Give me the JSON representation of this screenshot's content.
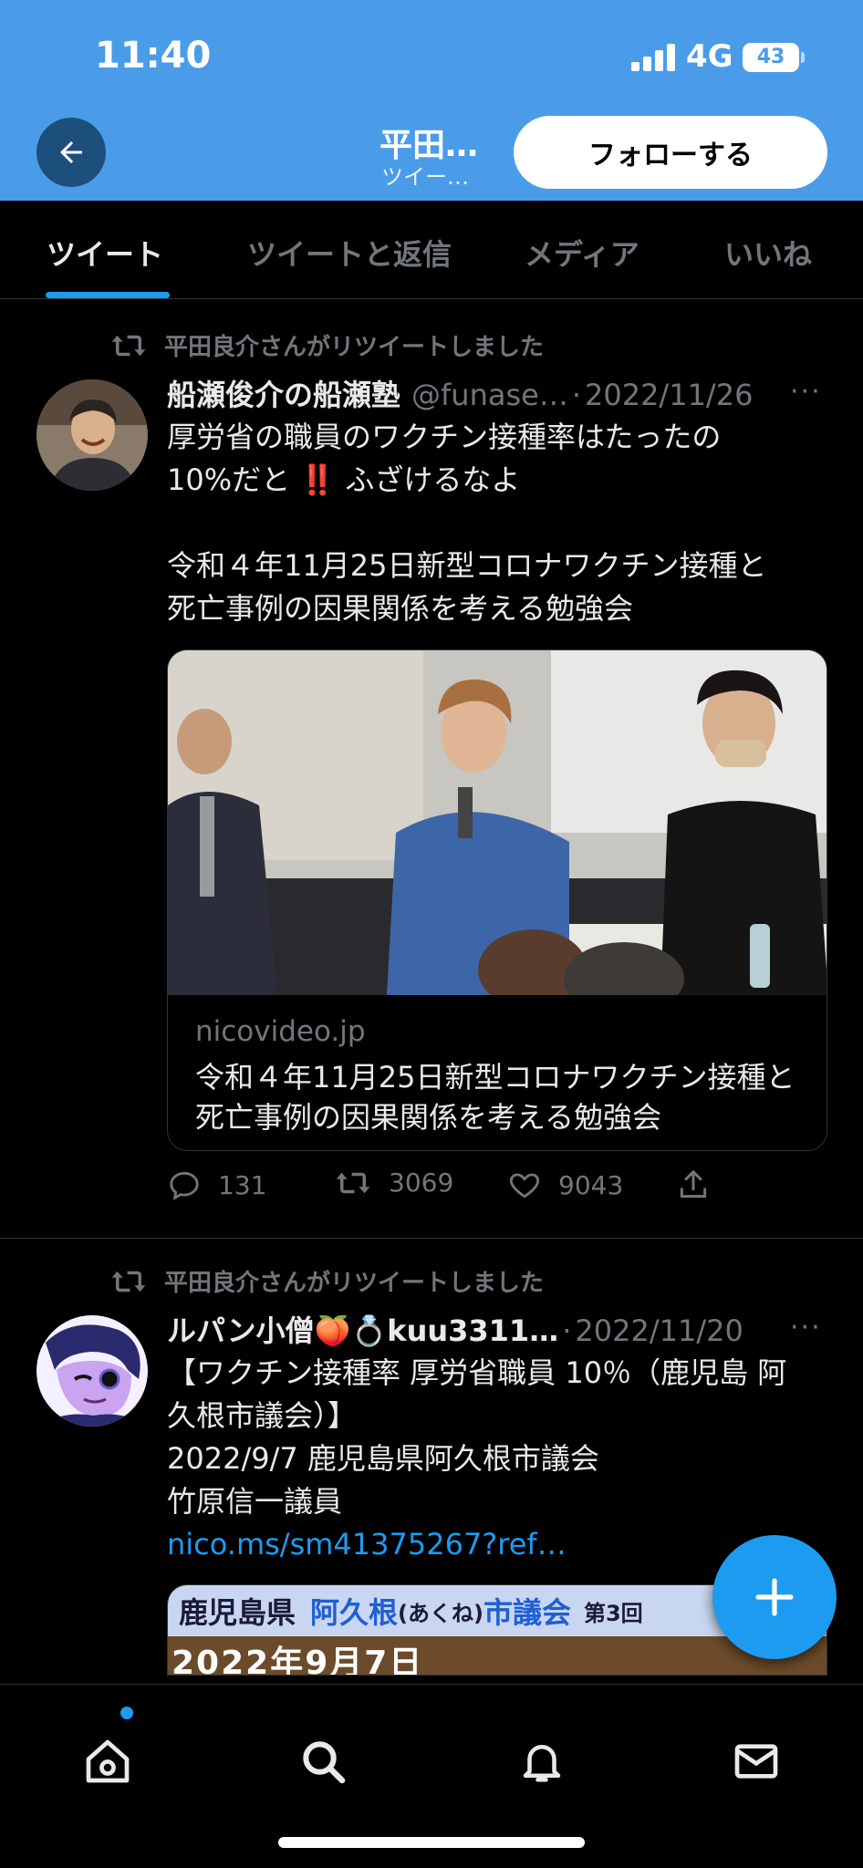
{
  "status_bar": {
    "time": "11:40",
    "network": "4G",
    "battery": "43"
  },
  "header": {
    "name": "平田…",
    "subtitle": "ツイー…",
    "follow_label": "フォローする"
  },
  "tabs": [
    {
      "label": "ツイート",
      "active": true
    },
    {
      "label": "ツイートと返信",
      "active": false
    },
    {
      "label": "メディア",
      "active": false
    },
    {
      "label": "いいね",
      "active": false
    }
  ],
  "tweets": [
    {
      "retweet_label": "平田良介さんがリツイートしました",
      "display_name": "船瀬俊介の船瀬塾",
      "handle": "@funase…",
      "dot": "·",
      "date": "2022/11/26",
      "more": "···",
      "text_lines": [
        "厚労省の職員のワクチン接種率はたったの",
        "10%だと ‼️ ふざけるなよ",
        "",
        "令和４年11月25日新型コロナワクチン接種と",
        "死亡事例の因果関係を考える勉強会"
      ],
      "card": {
        "domain": "nicovideo.jp",
        "title": "令和４年11月25日新型コロナワクチン接種と死亡事例の因果関係を考える勉強会"
      },
      "stats": {
        "replies": "131",
        "retweets": "3069",
        "likes": "9043"
      }
    },
    {
      "retweet_label": "平田良介さんがリツイートしました",
      "display_name": "ルパン小僧🍑💍kuu3311…",
      "handle": "",
      "dot": "·",
      "date": "2022/11/20",
      "more": "···",
      "text_lines": [
        "【ワクチン接種率 厚労省職員 10％（鹿児島 阿",
        "久根市議会）】",
        "2022/9/7 鹿児島県阿久根市議会",
        "竹原信一議員"
      ],
      "link": "nico.ms/sm41375267?ref…",
      "embed": {
        "line1_a": "鹿児島県",
        "line1_b": "阿久根",
        "line1_c": "(あくね)",
        "line1_d": "市議会",
        "line1_e": "第3回",
        "line2": "2022年9月7日"
      }
    }
  ],
  "colors": {
    "accent": "#1d9bf0",
    "header_bg": "#4a9ce8",
    "background": "#000000",
    "muted": "#71767b"
  },
  "icons": [
    "back-arrow-icon",
    "retweet-icon",
    "reply-icon",
    "like-icon",
    "share-icon",
    "compose-plus-icon",
    "home-icon",
    "search-icon",
    "notifications-icon",
    "messages-icon"
  ]
}
